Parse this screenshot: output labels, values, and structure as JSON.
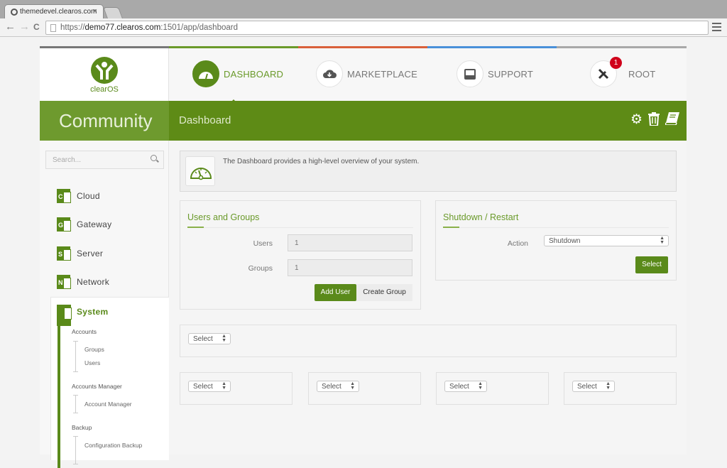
{
  "browser": {
    "tab_title": "themedevel.clearos.com",
    "tab_close": "×",
    "url_prefix": "https://",
    "url_host": "demo77.clearos.com",
    "url_rest": ":1501/app/dashboard",
    "back": "←",
    "forward": "→",
    "reload": "C"
  },
  "header": {
    "logo_text": "clearOS",
    "nav": [
      {
        "label": "DASHBOARD",
        "icon": "dashboard-gauge-icon",
        "active": true
      },
      {
        "label": "MARKETPLACE",
        "icon": "cloud-download-icon"
      },
      {
        "label": "SUPPORT",
        "icon": "inbox-icon"
      },
      {
        "label": "ROOT",
        "icon": "tools-icon",
        "badge": "1"
      }
    ],
    "strip_colors": [
      "#777777",
      "#6a9a2a",
      "#d9603b",
      "#4a90d9",
      "#a8a8a8"
    ]
  },
  "banner": {
    "edition": "Community",
    "page_title": "Dashboard",
    "icons": [
      "gear-icon",
      "trash-icon",
      "book-icon"
    ]
  },
  "sidebar": {
    "search_placeholder": "Search...",
    "categories": [
      {
        "label": "Cloud",
        "letter": "C"
      },
      {
        "label": "Gateway",
        "letter": "G"
      },
      {
        "label": "Server",
        "letter": "S"
      },
      {
        "label": "Network",
        "letter": "N"
      }
    ],
    "active_category": "System",
    "groups": [
      {
        "heading": "Accounts",
        "items": [
          "Groups",
          "Users"
        ]
      },
      {
        "heading": "Accounts Manager",
        "items": [
          "Account Manager"
        ]
      },
      {
        "heading": "Backup",
        "items": [
          "Configuration Backup"
        ]
      }
    ]
  },
  "main": {
    "info_text": "The Dashboard provides a high-level overview of your system.",
    "users_groups": {
      "title": "Users and Groups",
      "users_label": "Users",
      "users_value": "1",
      "groups_label": "Groups",
      "groups_value": "1",
      "add_user": "Add User",
      "create_group": "Create Group"
    },
    "shutdown": {
      "title": "Shutdown / Restart",
      "action_label": "Action",
      "action_value": "Shutdown",
      "select_button": "Select"
    },
    "widget_select": "Select"
  },
  "colors": {
    "brand_green": "#5a8a1a",
    "badge_red": "#d0021b"
  }
}
